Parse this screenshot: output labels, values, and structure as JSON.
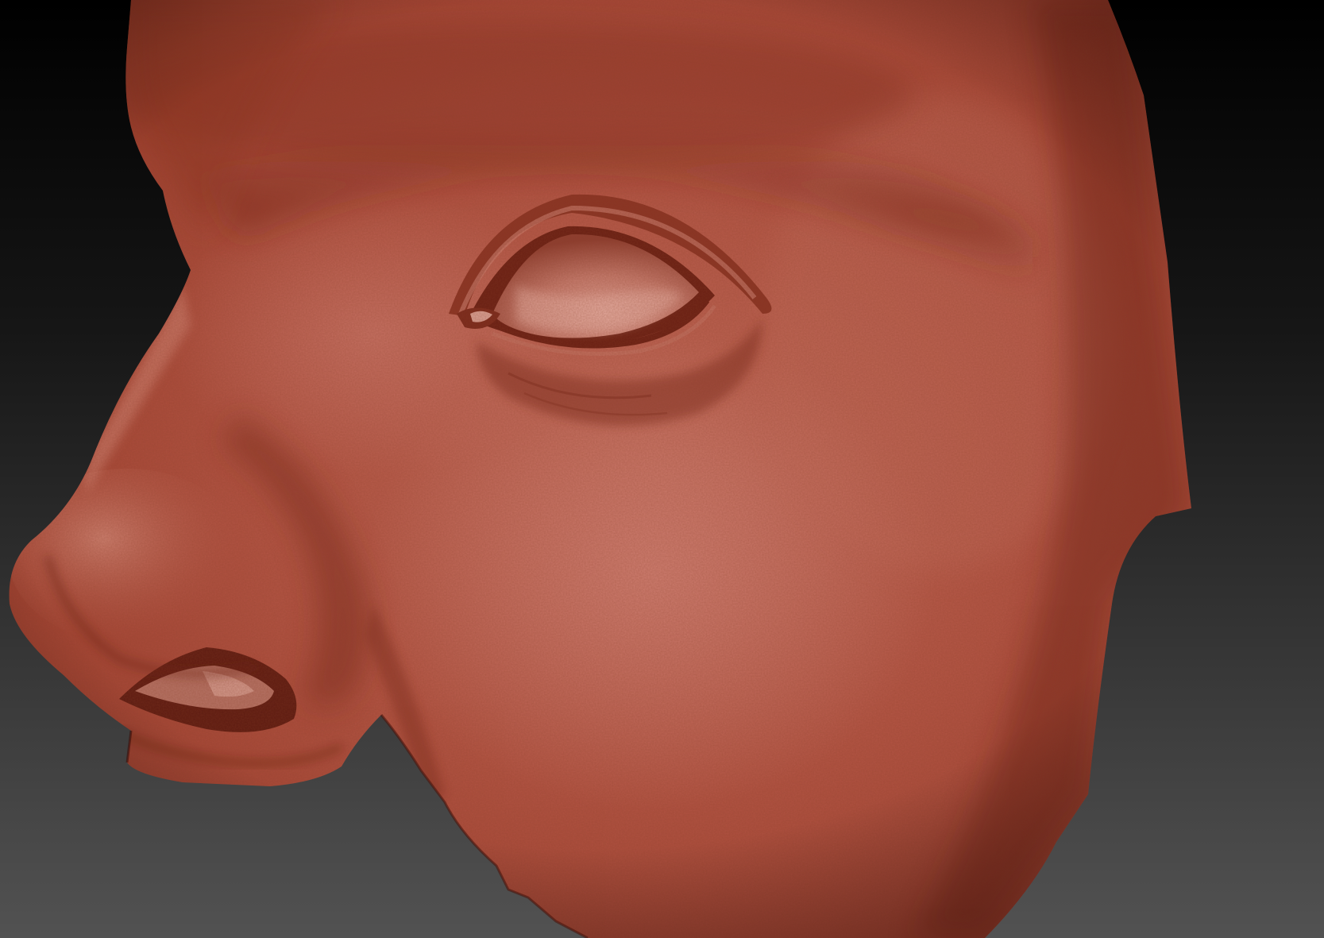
{
  "scene": {
    "subject": "",
    "material_color": "#b4503c",
    "highlight_color": "#d07a6a",
    "shadow_color": "#6e2418",
    "background_top": "#000000",
    "background_bottom": "#505050"
  }
}
